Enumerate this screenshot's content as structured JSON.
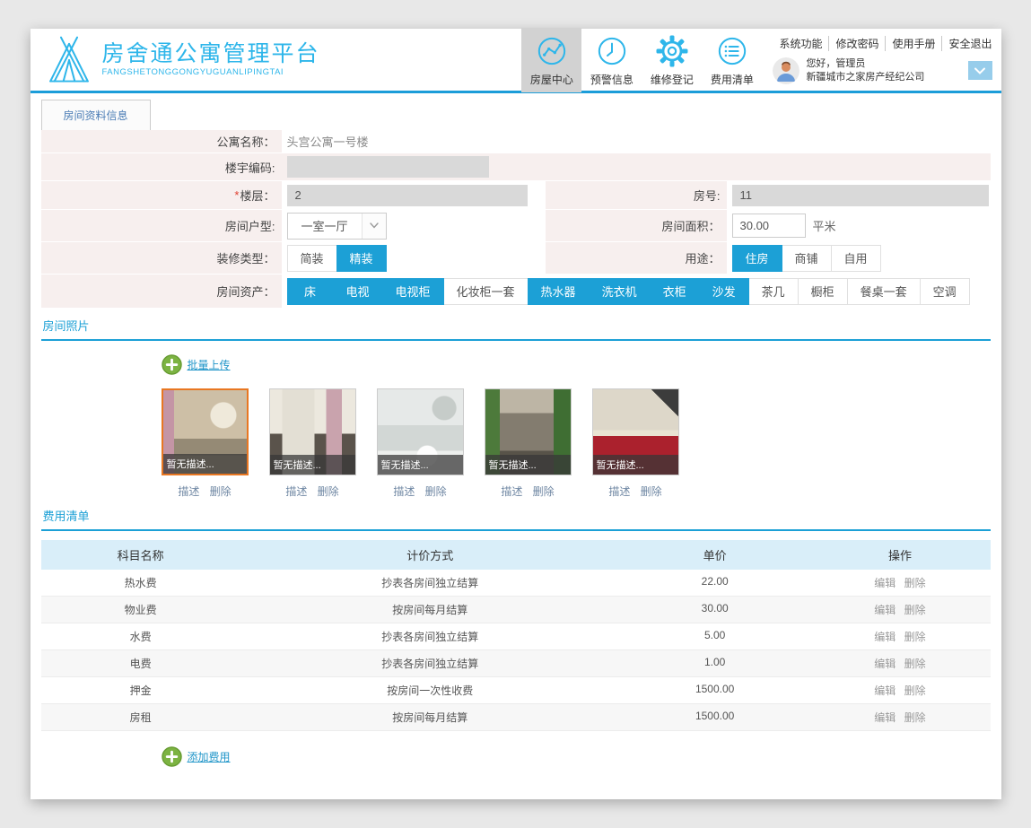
{
  "app": {
    "title": "房舍通公寓管理平台",
    "subtitle": "FANGSHETONGGONGYUGUANLIPINGTAI"
  },
  "colors": {
    "accent_blue": "#1ca0d6",
    "logo_cyan": "#2eb6ea",
    "header_border_blue": "#1b9dd9",
    "form_label_bg": "#f7efee",
    "table_header_bg": "#d9eef9",
    "selected_photo_border": "#e87722",
    "upload_green": "#7cb342"
  },
  "header": {
    "nav": [
      {
        "label": "房屋中心",
        "icon": "chart-icon",
        "active": true
      },
      {
        "label": "预警信息",
        "icon": "clock-icon",
        "active": false
      },
      {
        "label": "维修登记",
        "icon": "gear-icon",
        "active": false
      },
      {
        "label": "费用清单",
        "icon": "list-icon",
        "active": false
      }
    ],
    "links": [
      "系统功能",
      "修改密码",
      "使用手册",
      "安全退出"
    ],
    "user": {
      "greeting": "您好，管理员",
      "company": "新疆城市之家房产经纪公司"
    }
  },
  "tab": {
    "label": "房间资料信息"
  },
  "form": {
    "apartment_name": {
      "label": "公寓名称：",
      "value": "头宫公寓一号楼"
    },
    "building_code": {
      "label": "楼宇编码:",
      "value": ""
    },
    "floor": {
      "label": "楼层：",
      "required": "*",
      "value": "2"
    },
    "room_no": {
      "label": "房号:",
      "value": "11"
    },
    "room_type": {
      "label": "房间户型:",
      "value": "一室一厅"
    },
    "room_area": {
      "label": "房间面积：",
      "value": "30.00",
      "unit": "平米"
    },
    "decoration": {
      "label": "装修类型：",
      "options": [
        {
          "label": "简装",
          "selected": false
        },
        {
          "label": "精装",
          "selected": true
        }
      ]
    },
    "usage": {
      "label": "用途：",
      "options": [
        {
          "label": "住房",
          "selected": true
        },
        {
          "label": "商铺",
          "selected": false
        },
        {
          "label": "自用",
          "selected": false
        }
      ]
    },
    "assets": {
      "label": "房间资产：",
      "options": [
        {
          "label": "床",
          "selected": true
        },
        {
          "label": "电视",
          "selected": true
        },
        {
          "label": "电视柜",
          "selected": true
        },
        {
          "label": "化妆柜一套",
          "selected": false
        },
        {
          "label": "热水器",
          "selected": true
        },
        {
          "label": "洗衣机",
          "selected": true
        },
        {
          "label": "衣柜",
          "selected": true
        },
        {
          "label": "沙发",
          "selected": true
        },
        {
          "label": "茶几",
          "selected": false
        },
        {
          "label": "橱柜",
          "selected": false
        },
        {
          "label": "餐桌一套",
          "selected": false
        },
        {
          "label": "空调",
          "selected": false
        }
      ]
    }
  },
  "photos_section": {
    "title": "房间照片",
    "upload_label": "批量上传",
    "photos": [
      {
        "caption": "暂无描述...",
        "scene": "scene-living",
        "selected": true,
        "actions": [
          "描述",
          "删除"
        ]
      },
      {
        "caption": "暂无描述...",
        "scene": "scene-empty",
        "selected": false,
        "actions": [
          "描述",
          "删除"
        ]
      },
      {
        "caption": "暂无描述...",
        "scene": "scene-bath",
        "selected": false,
        "actions": [
          "描述",
          "删除"
        ]
      },
      {
        "caption": "暂无描述...",
        "scene": "scene-hall",
        "selected": false,
        "actions": [
          "描述",
          "删除"
        ]
      },
      {
        "caption": "暂无描述...",
        "scene": "scene-kitchen",
        "selected": false,
        "actions": [
          "描述",
          "删除"
        ]
      }
    ]
  },
  "fees_section": {
    "title": "费用清单",
    "add_label": "添加费用",
    "table": {
      "headers": [
        "科目名称",
        "计价方式",
        "单价",
        "操作"
      ],
      "rows": [
        {
          "name": "热水费",
          "method": "抄表各房间独立结算",
          "price": "22.00",
          "actions": [
            "编辑",
            "删除"
          ]
        },
        {
          "name": "物业费",
          "method": "按房间每月结算",
          "price": "30.00",
          "actions": [
            "编辑",
            "删除"
          ]
        },
        {
          "name": "水费",
          "method": "抄表各房间独立结算",
          "price": "5.00",
          "actions": [
            "编辑",
            "删除"
          ]
        },
        {
          "name": "电费",
          "method": "抄表各房间独立结算",
          "price": "1.00",
          "actions": [
            "编辑",
            "删除"
          ]
        },
        {
          "name": "押金",
          "method": "按房间一次性收费",
          "price": "1500.00",
          "actions": [
            "编辑",
            "删除"
          ]
        },
        {
          "name": "房租",
          "method": "按房间每月结算",
          "price": "1500.00",
          "actions": [
            "编辑",
            "删除"
          ]
        }
      ]
    }
  }
}
